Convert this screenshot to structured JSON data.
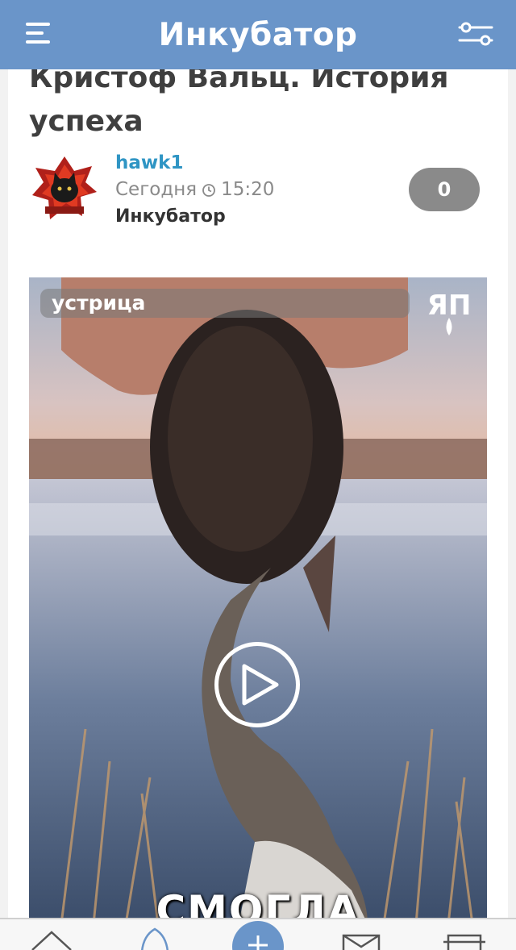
{
  "header": {
    "title": "Инкубатор",
    "menu_icon": "hamburger-menu-icon",
    "filter_icon": "sliders-icon",
    "accent_color": "#6a95c9"
  },
  "post": {
    "title": "Кристоф Вальц. История успеха",
    "author": "hawk1",
    "date": "Сегодня",
    "time": "15:20",
    "category": "Инкубатор",
    "comments_count": "0",
    "author_color": "#2f95c4"
  },
  "video": {
    "label": "устрица",
    "channel_logo_text": "ЯП",
    "caption": "СМОГЛА",
    "play_icon": "play-icon"
  },
  "bottom_nav": {
    "items": [
      "home-icon",
      "fire-icon",
      "add-icon",
      "mail-icon",
      "sofa-icon"
    ]
  }
}
